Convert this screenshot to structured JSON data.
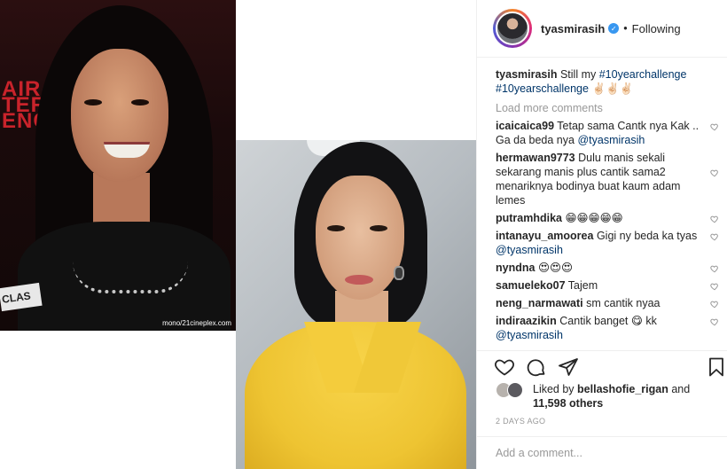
{
  "post": {
    "photos": {
      "old_photo_credit": "mono/21cineplex.com",
      "old_photo_signage": "AIR\nTERJ\nENGA",
      "old_photo_badge": "CLAS"
    }
  },
  "header": {
    "username": "tyasmirasih",
    "verified_glyph": "✓",
    "separator": "•",
    "follow_status": "Following"
  },
  "caption": {
    "username": "tyasmirasih",
    "text": "Still my",
    "hashtag1": "#10yearchallenge",
    "hashtag2": "#10yearschallenge",
    "emoji": "✌🏻✌🏻✌🏻"
  },
  "load_more": "Load more comments",
  "comments": [
    {
      "username": "icaicaica99",
      "text": "Tetap sama Cantk nya Kak .. Ga da beda nya",
      "mention": "@tyasmirasih"
    },
    {
      "username": "hermawan9773",
      "text": "Dulu manis sekali sekarang manis plus cantik sama2 menariknya bodinya buat kaum adam lemes",
      "mention": ""
    },
    {
      "username": "putramhdika",
      "text": "😁😁😁😁😁",
      "mention": ""
    },
    {
      "username": "intanayu_amoorea",
      "text": "Gigi ny beda ka tyas",
      "mention": "@tyasmirasih"
    },
    {
      "username": "nyndna",
      "text": "😍😍😍",
      "mention": ""
    },
    {
      "username": "samueleko07",
      "text": "Tajem",
      "mention": ""
    },
    {
      "username": "neng_narmawati",
      "text": "sm cantik nyaa",
      "mention": ""
    },
    {
      "username": "indiraazikin",
      "text": "Cantik banget 😋 kk",
      "mention": "@tyasmirasih"
    }
  ],
  "likes": {
    "prefix": "Liked by",
    "user": "bellashofie_rigan",
    "joiner": "and",
    "count": "11,598 others"
  },
  "timestamp": "2 DAYS AGO",
  "add_comment_placeholder": "Add a comment...",
  "icons": {
    "like": "heart-icon",
    "comment": "comment-icon",
    "share": "share-icon",
    "save": "bookmark-icon",
    "comment_like": "heart-icon"
  },
  "colors": {
    "link": "#003569",
    "verified": "#3897f0",
    "muted": "#999999",
    "text": "#262626"
  }
}
